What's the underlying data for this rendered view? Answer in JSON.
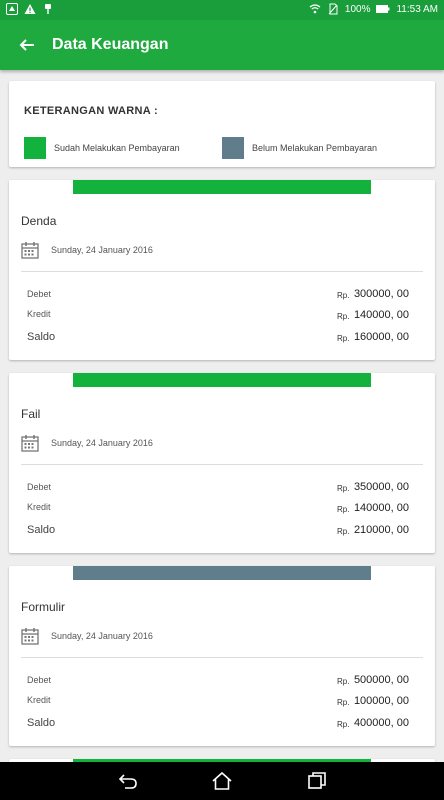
{
  "status": {
    "battery": "100%",
    "time": "11:53 AM"
  },
  "appbar": {
    "title": "Data Keuangan"
  },
  "legend": {
    "title": "KETERANGAN WARNA :",
    "paid_label": "Sudah Melakukan Pembayaran",
    "unpaid_label": "Belum Melakukan Pembayaran",
    "paid_color": "#13b23c",
    "unpaid_color": "#607d8b"
  },
  "labels": {
    "debet": "Debet",
    "kredit": "Kredit",
    "saldo": "Saldo",
    "currency": "Rp."
  },
  "entries": [
    {
      "name": "Denda",
      "date": "Sunday, 24 January 2016",
      "debet": "300000, 00",
      "kredit": "140000, 00",
      "saldo": "160000, 00",
      "status": "paid"
    },
    {
      "name": "Fail",
      "date": "Sunday, 24 January 2016",
      "debet": "350000, 00",
      "kredit": "140000, 00",
      "saldo": "210000, 00",
      "status": "paid"
    },
    {
      "name": "Formulir",
      "date": "Sunday, 24 January 2016",
      "debet": "500000, 00",
      "kredit": "100000, 00",
      "saldo": "400000, 00",
      "status": "unpaid"
    }
  ]
}
